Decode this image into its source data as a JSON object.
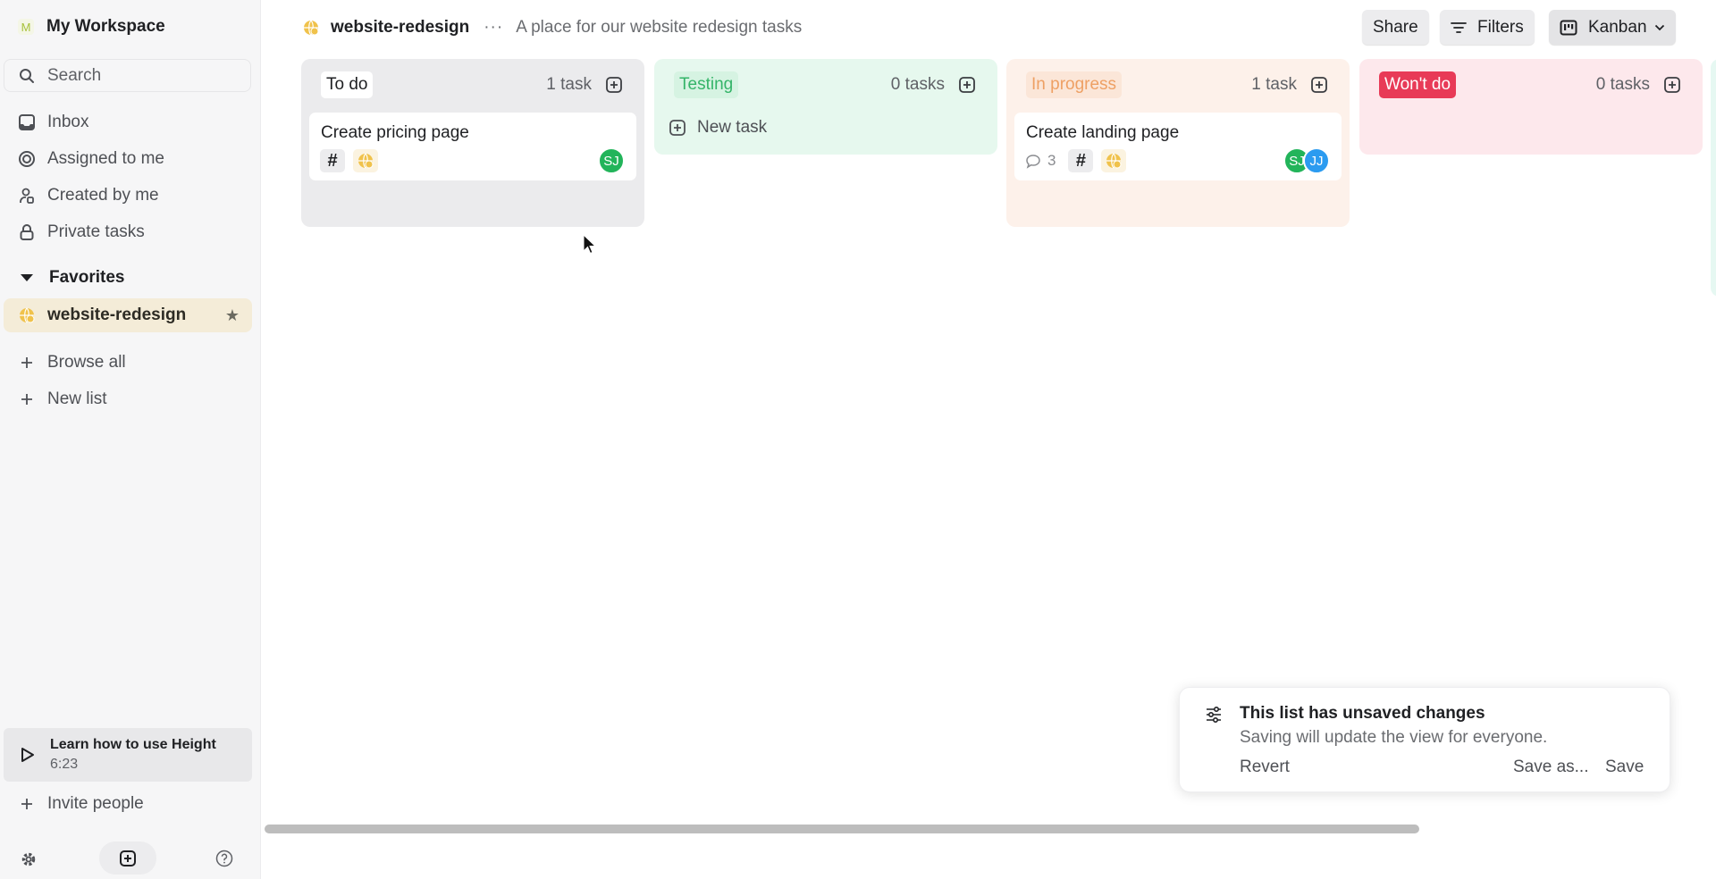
{
  "workspace": {
    "initial": "M",
    "name": "My Workspace"
  },
  "sidebar": {
    "search_placeholder": "Search",
    "nav": [
      {
        "label": "Inbox",
        "icon": "inbox-icon"
      },
      {
        "label": "Assigned to me",
        "icon": "target-icon"
      },
      {
        "label": "Created by me",
        "icon": "user-created-icon"
      },
      {
        "label": "Private tasks",
        "icon": "lock-icon"
      }
    ],
    "favorites_label": "Favorites",
    "favorites": [
      {
        "label": "website-redesign",
        "icon": "globe-icon",
        "starred": true
      }
    ],
    "browse_all": "Browse all",
    "new_list": "New list",
    "learn": {
      "title": "Learn how to use Height",
      "duration": "6:23"
    },
    "invite": "Invite people"
  },
  "header": {
    "title": "website-redesign",
    "more": "···",
    "description": "A place for our website redesign tasks",
    "share": "Share",
    "filters": "Filters",
    "view": "Kanban"
  },
  "board": {
    "columns": [
      {
        "status": "To do",
        "count": "1 task",
        "tasks": [
          {
            "title": "Create pricing page",
            "tags": [
              "#",
              "globe"
            ],
            "assignees": [
              "SJ"
            ]
          }
        ]
      },
      {
        "status": "Testing",
        "count": "0 tasks",
        "new_task": "New task",
        "tasks": []
      },
      {
        "status": "In progress",
        "count": "1 task",
        "tasks": [
          {
            "title": "Create landing page",
            "comments": "3",
            "tags": [
              "#",
              "globe"
            ],
            "assignees": [
              "SJ",
              "JJ"
            ]
          }
        ]
      },
      {
        "status": "Won't do",
        "count": "0 tasks",
        "tasks": []
      }
    ]
  },
  "toast": {
    "title": "This list has unsaved changes",
    "subtitle": "Saving will update the view for everyone.",
    "revert": "Revert",
    "save_as": "Save as...",
    "save": "Save"
  },
  "colors": {
    "todo": "#ebebed",
    "testing": "#34b468",
    "in_progress": "#eea064",
    "wont_do": "#e83a57",
    "favorite_highlight": "#f4ecd8"
  }
}
